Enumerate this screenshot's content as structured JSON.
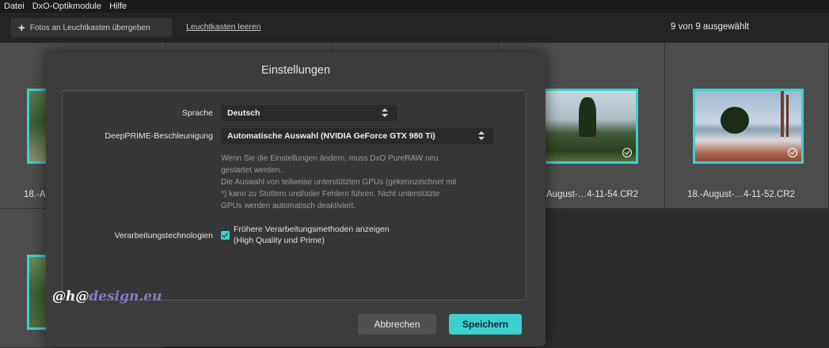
{
  "menubar": {
    "items": [
      "Datei",
      "DxO-Optikmodule",
      "Hilfe"
    ]
  },
  "toolbar": {
    "add_button_label": "Fotos an Leuchtkasten übergeben",
    "clear_link": "Leuchtkasten leeren",
    "selection_count": "9 von 9 ausgewählt"
  },
  "grid": {
    "cells": [
      {
        "label": "18.-A"
      },
      {
        "label": "August-…4-11-54.CR2"
      },
      {
        "label": "18.-August-…4-11-52.CR2"
      }
    ]
  },
  "dialog": {
    "title": "Einstellungen",
    "language_label": "Sprache",
    "language_value": "Deutsch",
    "deepprime_label": "DeepPRIME-Beschleunigung",
    "deepprime_value": "Automatische Auswahl (NVIDIA GeForce GTX 980 Ti)",
    "note_line1": "Wenn Sie die Einstellungen ändern, muss DxO PureRAW neu",
    "note_line2": "gestartet werden.",
    "note_line3": "Die Auswahl von teilweise unterstützten GPUs (gekennzeichnet mit",
    "note_line4": "*) kann zu Stottern und/oder Fehlern führen. Nicht unterstützte",
    "note_line5": "GPUs werden automatisch deaktiviert.",
    "processing_label": "Verarbeitungstechnologien",
    "checkbox_line1": "Frühere Verarbeitungsmethoden anzeigen",
    "checkbox_line2": "(High Quality und Prime)",
    "checkbox_checked": true,
    "cancel_label": "Abbrechen",
    "save_label": "Speichern"
  },
  "watermark": {
    "part_a": "@h@",
    "part_b": "design.eu"
  },
  "colors": {
    "accent": "#3cd0d0",
    "dialog_bg": "#3c3c3c",
    "grid_cell": "#4c4c4c"
  }
}
